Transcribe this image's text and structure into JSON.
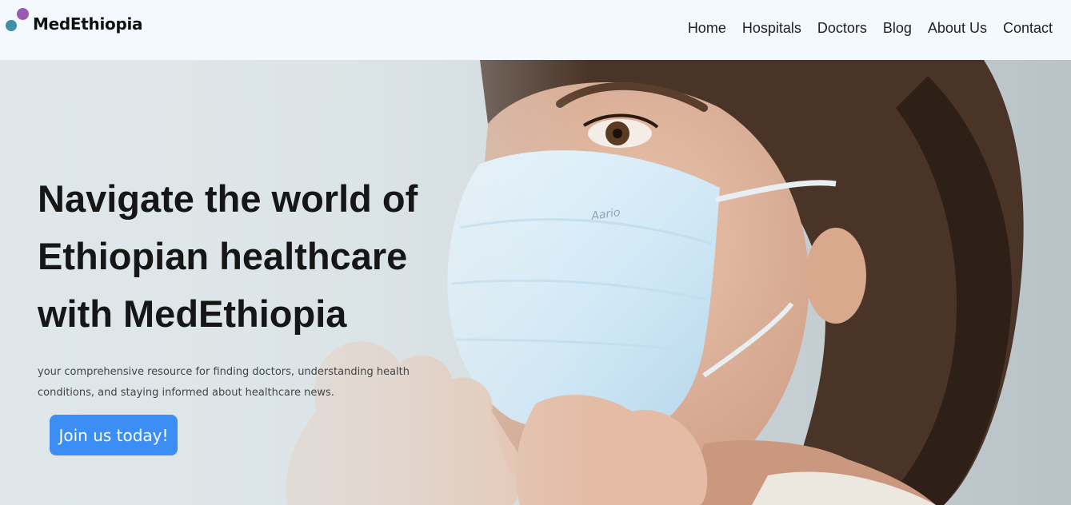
{
  "brand": {
    "name": "MedEthiopia",
    "colors": {
      "dot_teal": "#3f8fa6",
      "dot_purple": "#9b59b6",
      "accent": "#3c8ef5"
    }
  },
  "nav": {
    "items": [
      {
        "label": "Home"
      },
      {
        "label": "Hospitals"
      },
      {
        "label": "Doctors"
      },
      {
        "label": "Blog"
      },
      {
        "label": "About Us"
      },
      {
        "label": "Contact"
      }
    ]
  },
  "hero": {
    "title_lines": [
      "Navigate the world of",
      "Ethiopian healthcare",
      "with MedEthiopia"
    ],
    "subtitle_lines": [
      "your comprehensive resource for finding doctors, understanding health",
      "conditions, and staying informed about healthcare news."
    ],
    "cta_label": "Join us today!",
    "mask_brand": "Aario"
  }
}
